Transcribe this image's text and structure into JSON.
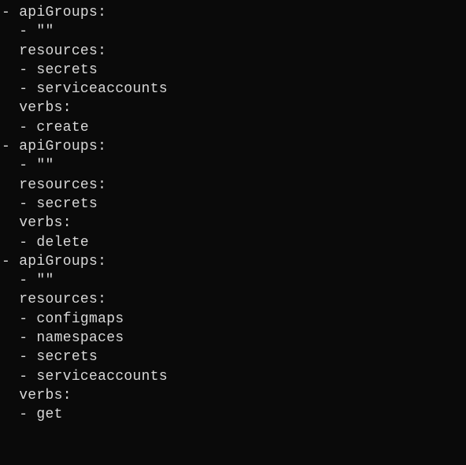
{
  "lines": [
    "- apiGroups:",
    "  - \"\"",
    "  resources:",
    "  - secrets",
    "  - serviceaccounts",
    "  verbs:",
    "  - create",
    "- apiGroups:",
    "  - \"\"",
    "  resources:",
    "  - secrets",
    "  verbs:",
    "  - delete",
    "- apiGroups:",
    "  - \"\"",
    "  resources:",
    "  - configmaps",
    "  - namespaces",
    "  - secrets",
    "  - serviceaccounts",
    "  verbs:",
    "  - get"
  ]
}
